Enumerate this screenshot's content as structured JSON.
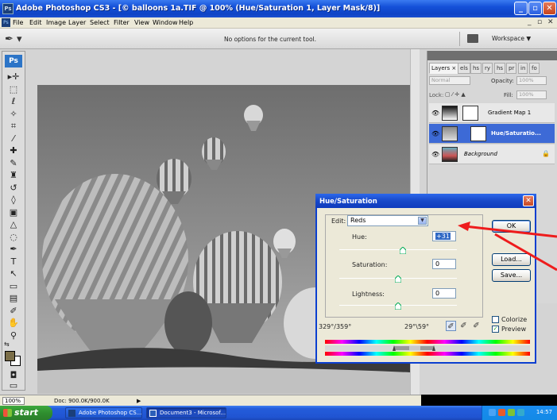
{
  "window": {
    "app_badge": "Ps",
    "title": "Adobe Photoshop CS3 - [© balloons 1a.TIF @ 100% (Hue/Saturation 1, Layer Mask/8)]",
    "min": "_",
    "max": "▫",
    "close": "✕"
  },
  "menu": {
    "items": [
      "File",
      "Edit",
      "Image",
      "Layer",
      "Select",
      "Filter",
      "View",
      "Window",
      "Help"
    ],
    "doc_min": "_",
    "doc_max": "▫",
    "doc_close": "✕"
  },
  "options_bar": {
    "tool_preset": "✒ ▾",
    "message": "No options for the current tool.",
    "workspace_label": "Workspace ▼"
  },
  "toolbox": {
    "logo": "Ps",
    "tools": [
      {
        "name": "move-tool",
        "glyph": "▸✛"
      },
      {
        "name": "marquee-tool",
        "glyph": "⬚"
      },
      {
        "name": "lasso-tool",
        "glyph": "ℓ"
      },
      {
        "name": "magic-wand-tool",
        "glyph": "✧"
      },
      {
        "name": "crop-tool",
        "glyph": "⌗"
      },
      {
        "name": "slice-tool",
        "glyph": "⁄"
      },
      {
        "name": "healing-brush-tool",
        "glyph": "✚"
      },
      {
        "name": "brush-tool",
        "glyph": "✎"
      },
      {
        "name": "clone-stamp-tool",
        "glyph": "♜"
      },
      {
        "name": "history-brush-tool",
        "glyph": "↺"
      },
      {
        "name": "eraser-tool",
        "glyph": "◊"
      },
      {
        "name": "gradient-tool",
        "glyph": "▣"
      },
      {
        "name": "blur-tool",
        "glyph": "△"
      },
      {
        "name": "dodge-tool",
        "glyph": "◌"
      },
      {
        "name": "pen-tool",
        "glyph": "✒"
      },
      {
        "name": "type-tool",
        "glyph": "T"
      },
      {
        "name": "path-selection-tool",
        "glyph": "↖"
      },
      {
        "name": "shape-tool",
        "glyph": "▭"
      },
      {
        "name": "notes-tool",
        "glyph": "▤"
      },
      {
        "name": "eyedropper-tool",
        "glyph": "✐"
      },
      {
        "name": "hand-tool",
        "glyph": "✋"
      },
      {
        "name": "zoom-tool",
        "glyph": "⚲"
      }
    ],
    "swap": "⇆",
    "quick_mask": "◘",
    "screen_mode": "▭"
  },
  "status_bar": {
    "zoom": "100%",
    "doc_info": "Doc: 900.0K/900.0K",
    "arrow": "▶"
  },
  "layers_panel": {
    "tabs": [
      "Layers ×",
      "els",
      "hs",
      "ry",
      "hs",
      "pr",
      "in",
      "fo"
    ],
    "blend_mode": "Normal",
    "opacity_label": "Opacity:",
    "opacity_value": "100%",
    "lock_label": "Lock:",
    "fill_label": "Fill:",
    "fill_value": "100%",
    "layers": [
      {
        "name": "Gradient Map 1",
        "selected": false
      },
      {
        "name": "Hue/Saturatio...",
        "selected": true
      },
      {
        "name": "Background",
        "selected": false
      }
    ],
    "eye": "👁",
    "lock_icon": "🔒"
  },
  "hue_saturation": {
    "title": "Hue/Saturation",
    "close": "✕",
    "edit_label": "Edit:",
    "edit_value": "Reds",
    "hue_label": "Hue:",
    "hue_value": "+31",
    "hue_level": 0.543,
    "saturation_label": "Saturation:",
    "saturation_value": "0",
    "saturation_level": 0.5,
    "lightness_label": "Lightness:",
    "lightness_value": "0",
    "lightness_level": 0.5,
    "range_left": "329°/359°",
    "range_right": "29°\\59°",
    "ok_label": "OK",
    "load_label": "Load...",
    "save_label": "Save...",
    "colorize_label": "Colorize",
    "colorize_checked": false,
    "preview_label": "Preview",
    "preview_checked": true,
    "check": "✓"
  },
  "taskbar": {
    "start_label": "start",
    "tasks": [
      {
        "label": "Adobe Photoshop CS...",
        "active": false
      },
      {
        "label": "Document3 - Microsof...",
        "active": true
      }
    ],
    "clock": "14:57"
  },
  "colors": {
    "xp_blue": "#245ddb",
    "selection": "#3d6ad6",
    "annotation_red": "#ee1c1c",
    "foreground_swatch": "#7b6e48"
  }
}
